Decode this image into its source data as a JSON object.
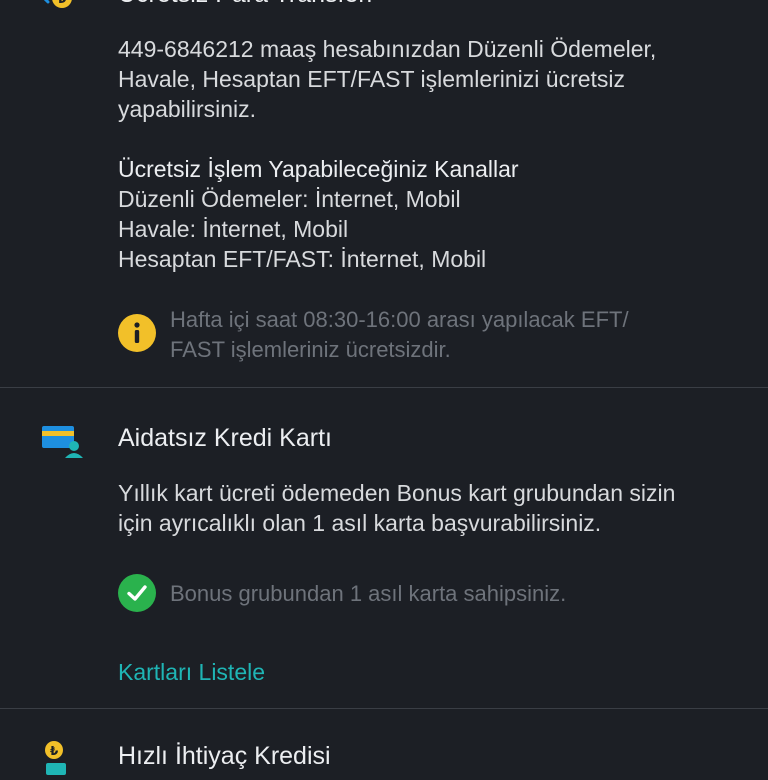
{
  "transfer_section": {
    "title": "Ücretsiz Para Transferi",
    "desc_lines": [
      "449-6846212 maaş hesabınızdan Düzenli Ödemeler,",
      "Havale, Hesaptan EFT/FAST işlemlerinizi ücretsiz",
      "yapabilirsiniz."
    ],
    "channels_title": "Ücretsiz İşlem Yapabileceğiniz Kanallar",
    "channels": [
      "Düzenli Ödemeler: İnternet, Mobil",
      "Havale: İnternet, Mobil",
      "Hesaptan EFT/FAST: İnternet, Mobil"
    ],
    "info_lines": [
      "Hafta içi saat 08:30-16:00 arası yapılacak EFT/",
      "FAST işlemleriniz ücretsizdir."
    ]
  },
  "card_section": {
    "title": "Aidatsız Kredi Kartı",
    "desc_lines": [
      "Yıllık kart ücreti ödemeden Bonus kart grubundan sizin",
      "için ayrıcalıklı olan 1 asıl karta başvurabilirsiniz."
    ],
    "status": "Bonus grubundan 1 asıl karta sahipsiniz.",
    "link": "Kartları Listele"
  },
  "loan_section": {
    "title": "Hızlı İhtiyaç Kredisi"
  },
  "colors": {
    "background": "#1c1f25",
    "accent": "#1fb5b5",
    "info": "#f2c029",
    "success": "#2ab24d"
  }
}
